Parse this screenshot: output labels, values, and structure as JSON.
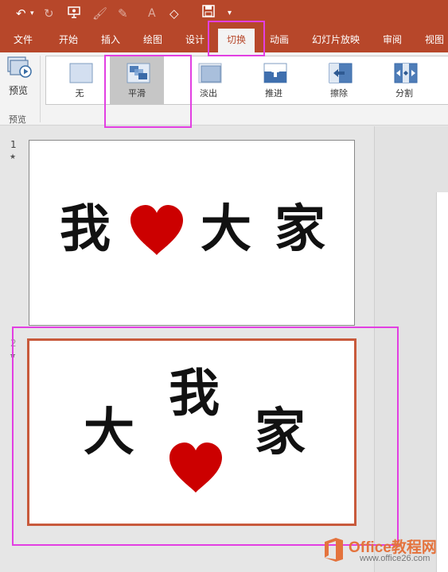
{
  "tabs": {
    "file": "文件",
    "home": "开始",
    "insert": "插入",
    "draw": "绘图",
    "design": "设计",
    "transitions": "切换",
    "animations": "动画",
    "slideshow": "幻灯片放映",
    "review": "审阅",
    "view": "视图"
  },
  "ribbon": {
    "preview_label": "预览",
    "group_label": "预览",
    "transitions": [
      {
        "label": "无",
        "icon": "none-transition-icon"
      },
      {
        "label": "平滑",
        "icon": "morph-transition-icon",
        "selected": true
      },
      {
        "label": "淡出",
        "icon": "fade-transition-icon"
      },
      {
        "label": "推进",
        "icon": "push-transition-icon"
      },
      {
        "label": "擦除",
        "icon": "wipe-transition-icon"
      },
      {
        "label": "分割",
        "icon": "split-transition-icon"
      }
    ]
  },
  "slides": [
    {
      "number": "1",
      "star": "★",
      "chars": [
        "我",
        "大",
        "家"
      ]
    },
    {
      "number": "2",
      "star": "★",
      "chars": [
        "我",
        "大",
        "家"
      ]
    }
  ],
  "watermark": {
    "title": "Office教程网",
    "url": "www.office26.com"
  },
  "colors": {
    "accent": "#b7472a",
    "highlight": "#e23fe2",
    "heart": "#cc0000",
    "selected_border": "#c85a3c",
    "watermark": "#e4733d"
  }
}
